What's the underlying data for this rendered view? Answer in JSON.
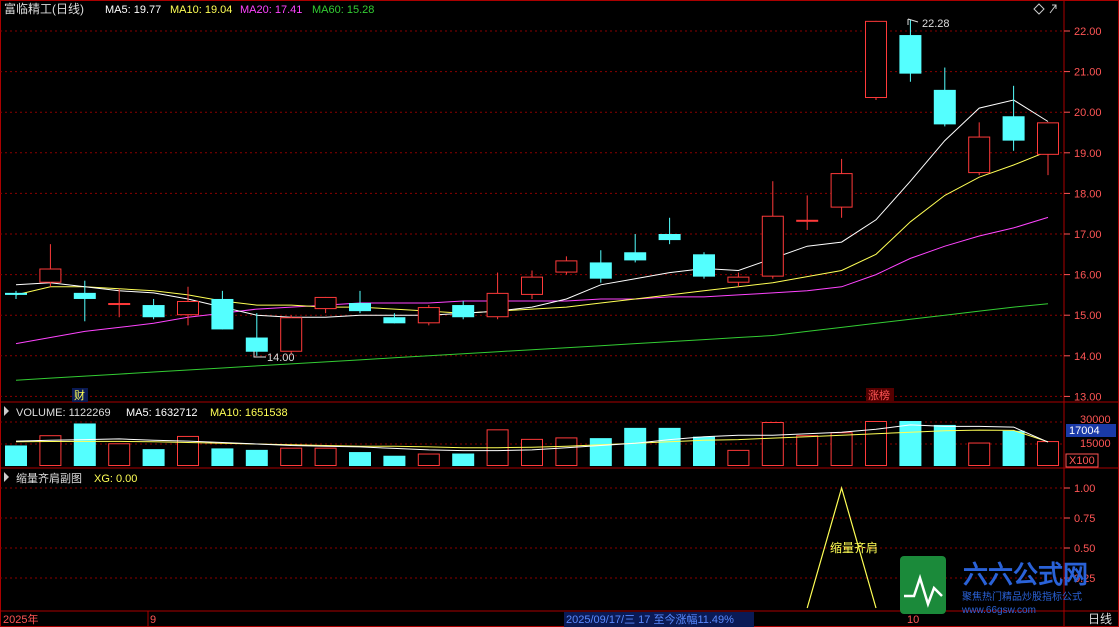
{
  "header": {
    "title": "富临精工(日线)",
    "ma5": "MA5: 19.77",
    "ma10": "MA10: 19.04",
    "ma20": "MA20: 17.41",
    "ma60": "MA60: 15.28"
  },
  "volume_header": {
    "label": "VOLUME: 1122269",
    "ma5": "MA5: 1632712",
    "ma10": "MA10: 1651538"
  },
  "indicator_header": {
    "label": "缩量齐肩副图",
    "xg": "XG: 0.00"
  },
  "price_axis": [
    "22.00",
    "21.00",
    "20.00",
    "19.00",
    "18.00",
    "17.00",
    "16.00",
    "15.00",
    "14.00",
    "13.00"
  ],
  "volume_axis": {
    "top": "30000",
    "mid": "15000",
    "current": "17004",
    "unit": "X100"
  },
  "indicator_axis": [
    "1.00",
    "0.75",
    "0.50",
    "0.25"
  ],
  "annotations": {
    "high": "22.28",
    "low": "14.00",
    "signal": "缩量齐肩",
    "marker_cai": "财",
    "marker_zhangbang": "涨榜"
  },
  "footer": {
    "year": "2025年",
    "month9": "9",
    "month10": "10",
    "status": "2025/09/17/三 17 至今涨幅11.49%",
    "period": "日线"
  },
  "watermark": {
    "brand": "六六公式网",
    "slogan": "聚焦热门精品炒股指标公式",
    "url": "www.66gsw.com"
  },
  "colors": {
    "up": "#ff3a3a",
    "down": "#54ffff",
    "ma5": "#ffffff",
    "ma10": "#ffff55",
    "ma20": "#ff44ff",
    "ma60": "#33cc33",
    "grid": "#8a0000",
    "axis_text": "#ff5555"
  },
  "chart_data": {
    "type": "candlestick",
    "title": "富临精工(日线)",
    "ohlc": [
      {
        "o": 15.55,
        "h": 15.6,
        "l": 15.4,
        "c": 15.5
      },
      {
        "o": 15.8,
        "h": 16.75,
        "l": 15.7,
        "c": 16.15
      },
      {
        "o": 15.55,
        "h": 15.85,
        "l": 14.85,
        "c": 15.4
      },
      {
        "o": 15.3,
        "h": 15.65,
        "l": 14.95,
        "c": 15.3
      },
      {
        "o": 15.25,
        "h": 15.4,
        "l": 14.9,
        "c": 14.95
      },
      {
        "o": 15.0,
        "h": 15.7,
        "l": 14.75,
        "c": 15.35
      },
      {
        "o": 15.4,
        "h": 15.6,
        "l": 14.65,
        "c": 14.65
      },
      {
        "o": 14.45,
        "h": 15.05,
        "l": 14.0,
        "c": 14.1
      },
      {
        "o": 14.1,
        "h": 15.0,
        "l": 14.05,
        "c": 14.95
      },
      {
        "o": 15.15,
        "h": 15.45,
        "l": 15.05,
        "c": 15.45
      },
      {
        "o": 15.3,
        "h": 15.6,
        "l": 15.05,
        "c": 15.1
      },
      {
        "o": 14.95,
        "h": 15.05,
        "l": 14.8,
        "c": 14.8
      },
      {
        "o": 14.8,
        "h": 15.25,
        "l": 14.75,
        "c": 15.2
      },
      {
        "o": 15.25,
        "h": 15.35,
        "l": 14.9,
        "c": 14.95
      },
      {
        "o": 14.95,
        "h": 16.05,
        "l": 14.9,
        "c": 15.55
      },
      {
        "o": 15.5,
        "h": 16.1,
        "l": 15.4,
        "c": 15.95
      },
      {
        "o": 16.05,
        "h": 16.45,
        "l": 16.0,
        "c": 16.35
      },
      {
        "o": 16.3,
        "h": 16.6,
        "l": 15.8,
        "c": 15.9
      },
      {
        "o": 16.55,
        "h": 17.0,
        "l": 16.3,
        "c": 16.35
      },
      {
        "o": 17.0,
        "h": 17.4,
        "l": 16.75,
        "c": 16.85
      },
      {
        "o": 16.5,
        "h": 16.55,
        "l": 15.9,
        "c": 15.95
      },
      {
        "o": 15.8,
        "h": 16.05,
        "l": 15.7,
        "c": 15.95
      },
      {
        "o": 15.95,
        "h": 18.3,
        "l": 15.9,
        "c": 17.45
      },
      {
        "o": 17.35,
        "h": 17.95,
        "l": 17.1,
        "c": 17.35
      },
      {
        "o": 17.65,
        "h": 18.85,
        "l": 17.4,
        "c": 18.5
      },
      {
        "o": 20.35,
        "h": 22.25,
        "l": 20.3,
        "c": 22.25
      },
      {
        "o": 21.9,
        "h": 22.28,
        "l": 20.75,
        "c": 20.95
      },
      {
        "o": 20.55,
        "h": 21.1,
        "l": 19.65,
        "c": 19.7
      },
      {
        "o": 18.5,
        "h": 19.75,
        "l": 18.45,
        "c": 19.4
      },
      {
        "o": 19.9,
        "h": 20.65,
        "l": 19.05,
        "c": 19.3
      },
      {
        "o": 18.95,
        "h": 19.75,
        "l": 18.45,
        "c": 19.75
      }
    ],
    "ma5": [
      15.75,
      15.8,
      15.7,
      15.6,
      15.55,
      15.4,
      15.2,
      15.0,
      14.95,
      14.95,
      15.0,
      15.0,
      15.0,
      15.05,
      15.1,
      15.2,
      15.4,
      15.75,
      15.9,
      16.05,
      16.15,
      16.1,
      16.4,
      16.7,
      16.8,
      17.35,
      18.3,
      19.3,
      20.1,
      20.3,
      19.77
    ],
    "ma10": [
      15.5,
      15.7,
      15.7,
      15.65,
      15.6,
      15.5,
      15.35,
      15.25,
      15.25,
      15.2,
      15.2,
      15.15,
      15.1,
      15.05,
      15.1,
      15.15,
      15.2,
      15.3,
      15.4,
      15.5,
      15.6,
      15.7,
      15.8,
      15.95,
      16.1,
      16.5,
      17.3,
      17.95,
      18.4,
      18.7,
      19.04
    ],
    "ma20": [
      14.3,
      14.45,
      14.6,
      14.7,
      14.8,
      14.95,
      15.05,
      15.15,
      15.2,
      15.25,
      15.3,
      15.3,
      15.3,
      15.35,
      15.35,
      15.35,
      15.35,
      15.4,
      15.4,
      15.45,
      15.45,
      15.5,
      15.55,
      15.6,
      15.7,
      16.0,
      16.4,
      16.7,
      16.95,
      17.15,
      17.41
    ],
    "ma60": [
      13.4,
      13.45,
      13.5,
      13.55,
      13.6,
      13.65,
      13.7,
      13.75,
      13.8,
      13.85,
      13.9,
      13.95,
      14.0,
      14.05,
      14.1,
      14.15,
      14.2,
      14.25,
      14.3,
      14.35,
      14.4,
      14.45,
      14.5,
      14.6,
      14.7,
      14.8,
      14.9,
      15.0,
      15.1,
      15.2,
      15.28
    ],
    "volume": [
      14000,
      21000,
      29000,
      15500,
      11500,
      20500,
      12000,
      11000,
      12500,
      12500,
      9500,
      7000,
      8500,
      8500,
      25000,
      18500,
      19500,
      19000,
      26000,
      26000,
      20000,
      11000,
      30000,
      21000,
      23000,
      36000,
      41000,
      28000,
      16000,
      24000,
      17004
    ],
    "volume_ma5": [
      17000,
      17500,
      18000,
      18500,
      17500,
      17000,
      16000,
      15000,
      14000,
      13500,
      13000,
      12000,
      11000,
      10500,
      10500,
      11000,
      12500,
      14000,
      15500,
      18000,
      20000,
      21000,
      21000,
      22000,
      23000,
      25000,
      28000,
      27000,
      27000,
      26500,
      16327
    ],
    "volume_ma10": [
      16500,
      16700,
      16800,
      16800,
      16500,
      16000,
      15500,
      15000,
      14500,
      14000,
      13500,
      13500,
      13000,
      12500,
      12500,
      12800,
      13500,
      14500,
      15500,
      16500,
      17500,
      18000,
      19000,
      20000,
      21000,
      22000,
      23000,
      24000,
      24500,
      24300,
      16515
    ],
    "xg": [
      0,
      0,
      0,
      0,
      0,
      0,
      0,
      0,
      0,
      0,
      0,
      0,
      0,
      0,
      0,
      0,
      0,
      0,
      0,
      0,
      0,
      0,
      0,
      0,
      1,
      0,
      0,
      0,
      0,
      0,
      0
    ],
    "price_ylim": [
      13.0,
      22.5
    ],
    "volume_ylim": [
      0,
      30000
    ],
    "xg_ylim": [
      0,
      1.0
    ]
  }
}
